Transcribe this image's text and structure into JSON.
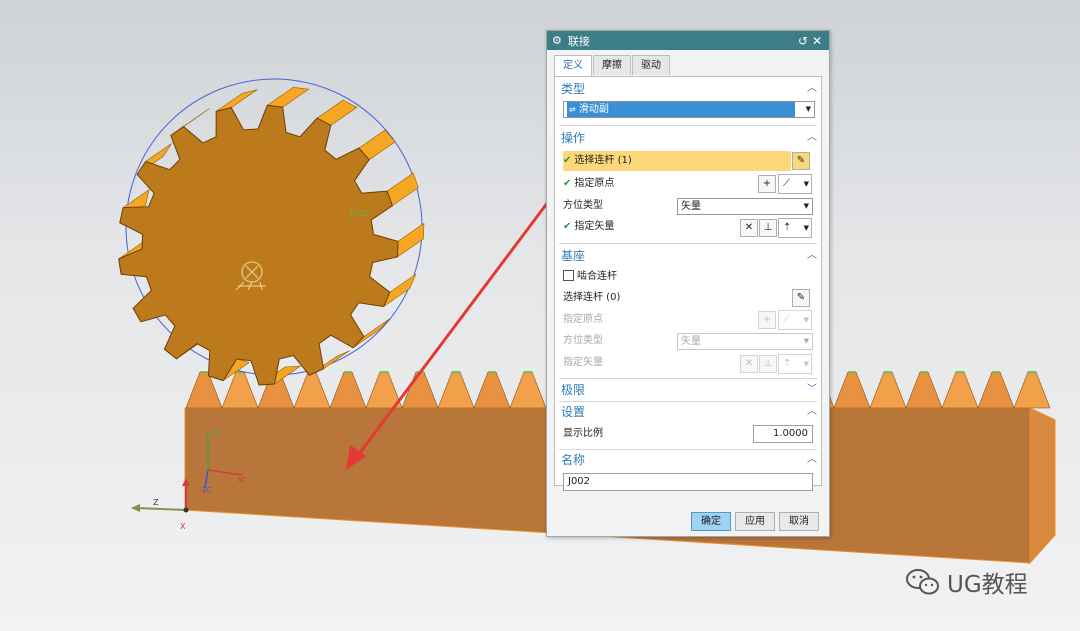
{
  "colors": {
    "title_bar": "#3d7d86",
    "accent_blue": "#2e7db8",
    "selection_highlight": "#fcd87a",
    "gear_orange": "#f5a623",
    "gear_face": "#bd7a1c",
    "rack_face": "#b9763a",
    "arrow_red": "#e53935",
    "primary_button": "#9fd3f2"
  },
  "model": {
    "gear_label": "J002"
  },
  "csys": {
    "y_label": "YC",
    "x_label": "XC",
    "z_label": "ZC",
    "z_axis": "Z",
    "x_axis": "X"
  },
  "dialog": {
    "title": "联接",
    "title_icon": "gear-icon",
    "reset_icon": "reset-icon",
    "close_icon": "close-icon",
    "tabs": [
      "定义",
      "摩擦",
      "驱动"
    ],
    "type_section": {
      "heading": "类型",
      "selected": "滑动副"
    },
    "action_section": {
      "heading": "操作",
      "select_link": "选择连杆 (1)",
      "specify_origin": "指定原点",
      "orientation_type": "方位类型",
      "orientation_value": "矢量",
      "specify_vector": "指定矢量"
    },
    "base_section": {
      "heading": "基座",
      "mesh_link": "啮合连杆",
      "select_link": "选择连杆 (0)",
      "specify_origin": "指定原点",
      "orientation_type": "方位类型",
      "orientation_value": "矢量",
      "specify_vector": "指定矢量"
    },
    "limits_section": {
      "heading": "极限"
    },
    "settings_section": {
      "heading": "设置",
      "scale_label": "显示比例",
      "scale_value": "1.0000"
    },
    "name_section": {
      "heading": "名称",
      "name_value": "J002"
    },
    "buttons": {
      "ok": "确定",
      "apply": "应用",
      "cancel": "取消"
    }
  },
  "watermark": {
    "icon": "wechat-icon",
    "text": "UG教程"
  }
}
